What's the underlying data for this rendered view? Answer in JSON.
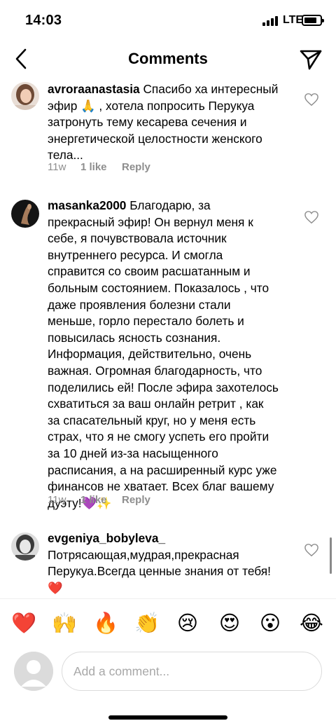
{
  "status_bar": {
    "time": "14:03",
    "network": "LTE",
    "battery_level": 0.8
  },
  "header": {
    "title": "Comments",
    "back_icon": "chevron-left-icon",
    "send_icon": "paper-plane-icon"
  },
  "comments": [
    {
      "username": "avroraanastasia",
      "text": "Спасибо ха интересный эфир 🙏 , хотела попросить Перукуа  затронуть тему кесарева сечения и энергетической целостности женского тела...",
      "time": "11w",
      "likes": "1 like",
      "reply": "Reply"
    },
    {
      "username": "masanka2000",
      "text": "Благодарю, за прекрасный эфир! Он вернул меня к себе, я почувствовала источник внутреннего ресурса. И смогла справится со своим расшатанным и больным состоянием. Показалось , что даже проявления болезни стали меньше, горло перестало болеть и повысилась ясность сознания. Информация, действительно, очень важная. Огромная благодарность, что поделились ей! После эфира захотелось схватиться за ваш онлайн ретрит , как за спасательный круг, но у меня есть страх, что я не смогу успеть его пройти за 10 дней из-за насыщенного расписания, а на расширенный курс уже финансов не хватает.  Всех благ вашему дуэту!💜✨",
      "time": "11w",
      "likes": "1 like",
      "reply": "Reply"
    },
    {
      "username": "evgeniya_bobyleva_",
      "text": "Потрясающая,мудрая,прекрасная Перукуа.Всегда ценные знания от тебя!❤️",
      "time": "",
      "likes": "",
      "reply": ""
    }
  ],
  "emoji_bar": [
    "❤️",
    "🙌",
    "🔥",
    "👏",
    "😢",
    "😍",
    "😮",
    "😂"
  ],
  "composer": {
    "placeholder": "Add a comment..."
  },
  "colors": {
    "meta_gray": "#8e8e8e",
    "border": "#dbdbdb"
  }
}
